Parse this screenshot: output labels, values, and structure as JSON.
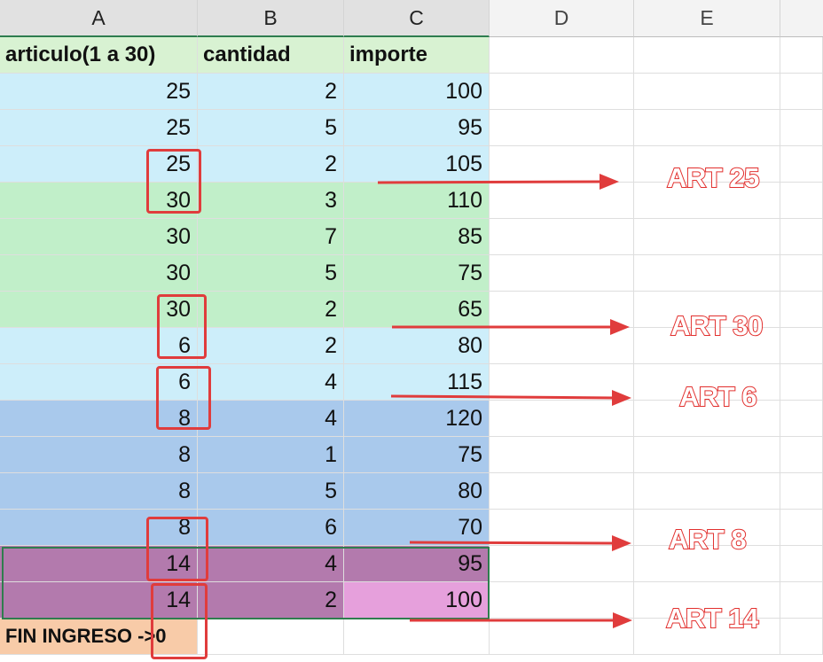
{
  "columns": [
    "A",
    "B",
    "C",
    "D",
    "E"
  ],
  "header_row": {
    "a": "articulo(1 a 30)",
    "b": "cantidad",
    "c": "importe"
  },
  "rows": [
    {
      "a": "25",
      "b": "2",
      "c": "100",
      "color": "#cdeefa"
    },
    {
      "a": "25",
      "b": "5",
      "c": "95",
      "color": "#cdeefa"
    },
    {
      "a": "25",
      "b": "2",
      "c": "105",
      "color": "#cdeefa"
    },
    {
      "a": "30",
      "b": "3",
      "c": "110",
      "color": "#c1efc9"
    },
    {
      "a": "30",
      "b": "7",
      "c": "85",
      "color": "#c1efc9"
    },
    {
      "a": "30",
      "b": "5",
      "c": "75",
      "color": "#c1efc9"
    },
    {
      "a": "30",
      "b": "2",
      "c": "65",
      "color": "#c1efc9"
    },
    {
      "a": "6",
      "b": "2",
      "c": "80",
      "color": "#cdeefa"
    },
    {
      "a": "6",
      "b": "4",
      "c": "115",
      "color": "#cdeefa"
    },
    {
      "a": "8",
      "b": "4",
      "c": "120",
      "color": "#a9c9ec"
    },
    {
      "a": "8",
      "b": "1",
      "c": "75",
      "color": "#a9c9ec"
    },
    {
      "a": "8",
      "b": "5",
      "c": "80",
      "color": "#a9c9ec"
    },
    {
      "a": "8",
      "b": "6",
      "c": "70",
      "color": "#a9c9ec"
    },
    {
      "a": "14",
      "b": "4",
      "c": "95",
      "color": "#b37aad"
    },
    {
      "a": "14",
      "b": "2",
      "c": "100",
      "color": "#b37aad",
      "c_color": "#e6a0dc"
    }
  ],
  "footer": {
    "a": "FIN INGRESO ->0",
    "color": "#f8cba8"
  },
  "header_color": "#d8f2d2",
  "annotations": [
    {
      "label": "ART 25"
    },
    {
      "label": "ART 30"
    },
    {
      "label": "ART 6"
    },
    {
      "label": "ART 8"
    },
    {
      "label": "ART 14"
    }
  ],
  "annotation_color": "#e2312f"
}
